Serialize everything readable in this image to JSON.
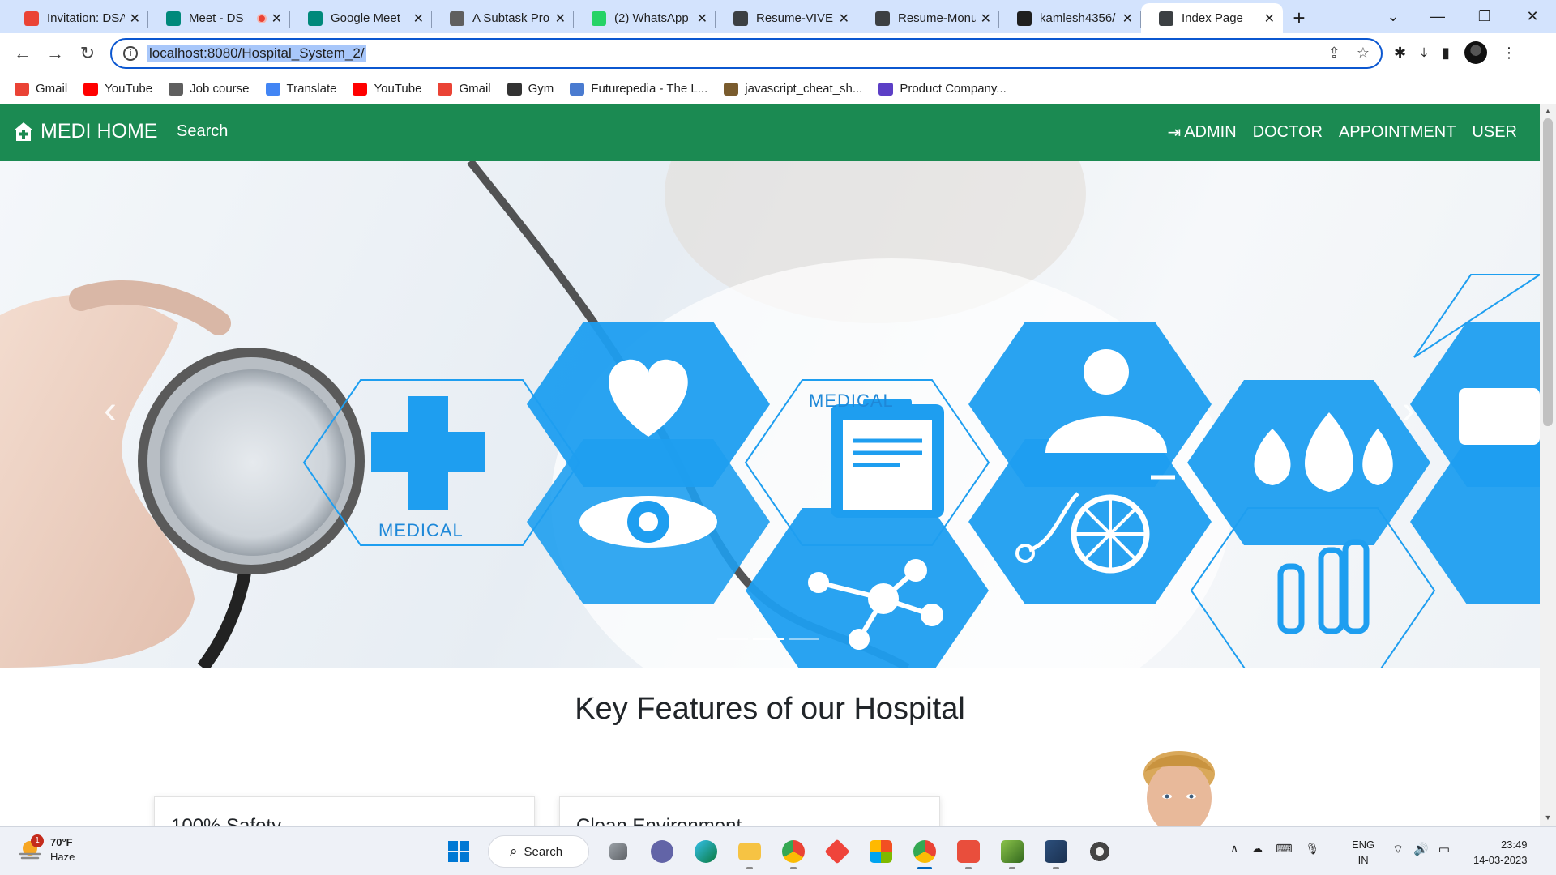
{
  "browser": {
    "tabs": [
      {
        "title": "Invitation: DSA",
        "icon": "gmail-icon",
        "color": "#ea4335"
      },
      {
        "title": "Meet - DS",
        "icon": "google-meet-icon",
        "color": "#00897b",
        "recording": true
      },
      {
        "title": "Google Meet",
        "icon": "google-meet-icon",
        "color": "#00897b"
      },
      {
        "title": "A Subtask Pro",
        "icon": "cc-icon",
        "color": "#5f5f5f"
      },
      {
        "title": "(2) WhatsApp",
        "icon": "whatsapp-icon",
        "color": "#25d366"
      },
      {
        "title": "Resume-VIVEK",
        "icon": "globe-icon",
        "color": "#3c4043"
      },
      {
        "title": "Resume-Monu",
        "icon": "globe-icon",
        "color": "#3c4043"
      },
      {
        "title": "kamlesh4356/",
        "icon": "github-icon",
        "color": "#1f1f1f"
      },
      {
        "title": "Index Page",
        "icon": "globe-icon",
        "color": "#3c4043",
        "active": true
      }
    ],
    "url": "localhost:8080/Hospital_System_2/",
    "bookmarks": [
      {
        "label": "Gmail",
        "icon": "gmail-icon",
        "color": "#ea4335"
      },
      {
        "label": "YouTube",
        "icon": "youtube-icon",
        "color": "#ff0000"
      },
      {
        "label": "Job course",
        "icon": "bookmark-icon",
        "color": "#5f5f5f"
      },
      {
        "label": "Translate",
        "icon": "translate-icon",
        "color": "#4285f4"
      },
      {
        "label": "YouTube",
        "icon": "youtube-icon",
        "color": "#ff0000"
      },
      {
        "label": "Gmail",
        "icon": "gmail-icon",
        "color": "#ea4335"
      },
      {
        "label": "Gym",
        "icon": "gym-icon",
        "color": "#333333"
      },
      {
        "label": "Futurepedia - The L...",
        "icon": "futurepedia-icon",
        "color": "#4a7bd0"
      },
      {
        "label": "javascript_cheat_sh...",
        "icon": "bookmark-icon",
        "color": "#7a5c2e"
      },
      {
        "label": "Product Company...",
        "icon": "list-icon",
        "color": "#5c3fc6"
      }
    ]
  },
  "site": {
    "brand": "MEDI HOME",
    "search": "Search",
    "nav": [
      "ADMIN",
      "DOCTOR",
      "APPOINTMENT",
      "USER"
    ],
    "hero_labels": [
      "MEDICAL",
      "MEDICAL"
    ],
    "features_title": "Key Features of our Hospital",
    "cards": [
      "100% Safety",
      "Clean Environment"
    ],
    "colors": {
      "nav_green": "#1b8a52",
      "hero_blue": "#1e9ef0"
    }
  },
  "taskbar": {
    "weather_temp": "70°F",
    "weather_desc": "Haze",
    "weather_badge": "1",
    "search_label": "Search",
    "lang_line1": "ENG",
    "lang_line2": "IN",
    "time": "23:49",
    "date": "14-03-2023"
  }
}
